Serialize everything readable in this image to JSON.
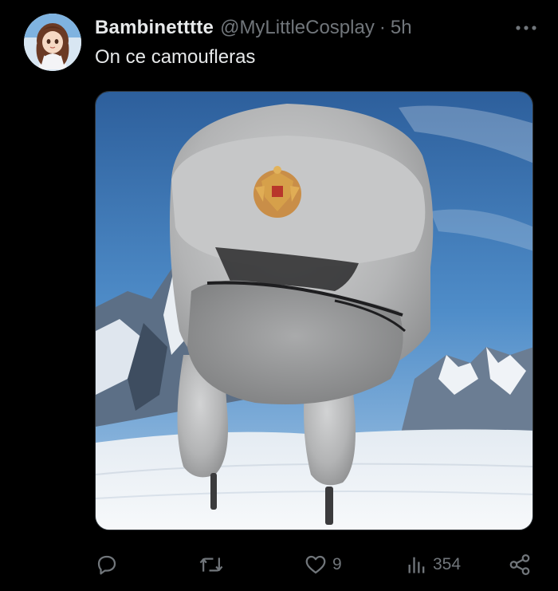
{
  "tweet": {
    "display_name": "Bambinetttte",
    "handle": "@MyLittleCosplay",
    "separator": "·",
    "time": "5h",
    "text": "On ce camoufleras"
  },
  "media": {
    "icon": "photo-ushanka-hat",
    "sky_color": "#3d78b8",
    "snow_color": "#f2f5f8",
    "fur_color": "#b9babb"
  },
  "actions": {
    "reply_icon": "reply-icon",
    "retweet_icon": "retweet-icon",
    "like_icon": "heart-icon",
    "like_count": "9",
    "views_icon": "views-icon",
    "views_count": "354",
    "share_icon": "share-icon"
  },
  "colors": {
    "background": "#000000",
    "text_primary": "#e7e9ea",
    "text_secondary": "#71767b"
  }
}
